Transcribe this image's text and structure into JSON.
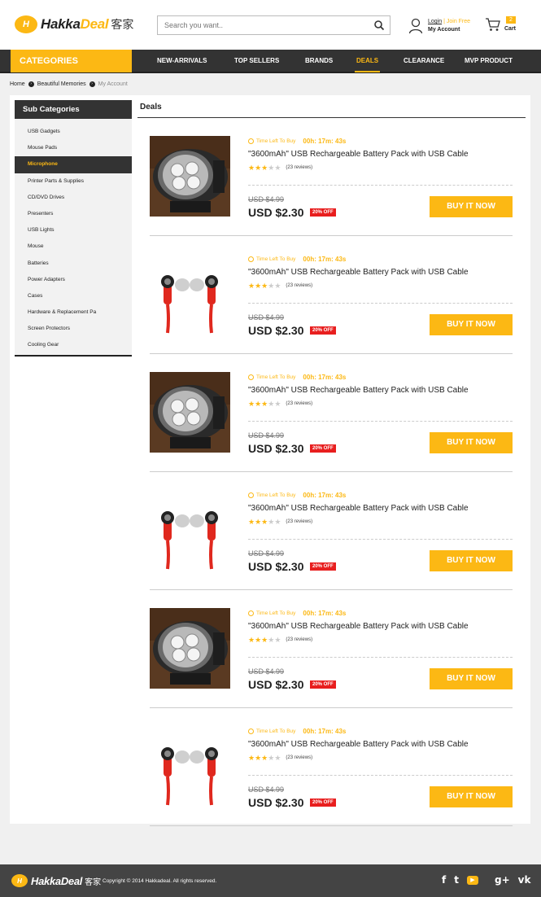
{
  "header": {
    "logo_mark": "H",
    "logo_text_1": "Hakka",
    "logo_text_2": "Deal",
    "logo_cn": "客家",
    "search_placeholder": "Search you want..",
    "login": "Login",
    "separator": "|",
    "join": "Join Free",
    "my_account": "My Account",
    "cart_count": "2",
    "cart_label": "Cart"
  },
  "nav": {
    "categories": "CATEGORIES",
    "items": [
      {
        "label": "NEW-ARRIVALS"
      },
      {
        "label": "TOP SELLERS"
      },
      {
        "label": "BRANDS"
      },
      {
        "label": "DEALS"
      },
      {
        "label": "CLEARANCE"
      },
      {
        "label": "MVP PRODUCT"
      }
    ],
    "active": "DEALS"
  },
  "breadcrumb": [
    "Home",
    "Beautiful Memories",
    "My Account"
  ],
  "sidebar": {
    "title": "Sub Categories",
    "items": [
      "USB Gadgets",
      "Mouse Pads",
      "Microphone",
      "Printer Parts & Supplies",
      "CD/DVD Drives",
      "Presenters",
      "USB Lights",
      "Mouse",
      "Batteries",
      "Power Adapters",
      "Cases",
      "Hardware & Replacement Pa",
      "Screen Protectors",
      "Cooling Gear"
    ],
    "active": "Microphone"
  },
  "deals": {
    "title": "Deals",
    "items": [
      {
        "image": "flashlight",
        "timer_label": "Time Left To Buy",
        "timer": "00h: 17m: 43s",
        "title": "\"3600mAh\" USB Rechargeable Battery Pack with USB Cable",
        "rating": 3,
        "reviews": "(23 reviews)",
        "old_price": "USD $4.99",
        "price": "USD $2.30",
        "discount": "20% OFF",
        "button": "BUY IT NOW"
      },
      {
        "image": "earphones",
        "timer_label": "Time Left To Buy",
        "timer": "00h: 17m: 43s",
        "title": "\"3600mAh\" USB Rechargeable Battery Pack with USB Cable",
        "rating": 3,
        "reviews": "(23 reviews)",
        "old_price": "USD $4.99",
        "price": "USD $2.30",
        "discount": "20% OFF",
        "button": "BUY IT NOW"
      },
      {
        "image": "flashlight",
        "timer_label": "Time Left To Buy",
        "timer": "00h: 17m: 43s",
        "title": "\"3600mAh\" USB Rechargeable Battery Pack with USB Cable",
        "rating": 3,
        "reviews": "(23 reviews)",
        "old_price": "USD $4.99",
        "price": "USD $2.30",
        "discount": "20% OFF",
        "button": "BUY IT NOW"
      },
      {
        "image": "earphones",
        "timer_label": "Time Left To Buy",
        "timer": "00h: 17m: 43s",
        "title": "\"3600mAh\" USB Rechargeable Battery Pack with USB Cable",
        "rating": 3,
        "reviews": "(23 reviews)",
        "old_price": "USD $4.99",
        "price": "USD $2.30",
        "discount": "20% OFF",
        "button": "BUY IT NOW"
      },
      {
        "image": "flashlight",
        "timer_label": "Time Left To Buy",
        "timer": "00h: 17m: 43s",
        "title": "\"3600mAh\" USB Rechargeable Battery Pack with USB Cable",
        "rating": 3,
        "reviews": "(23 reviews)",
        "old_price": "USD $4.99",
        "price": "USD $2.30",
        "discount": "20% OFF",
        "button": "BUY IT NOW"
      },
      {
        "image": "earphones",
        "timer_label": "Time Left To Buy",
        "timer": "00h: 17m: 43s",
        "title": "\"3600mAh\" USB Rechargeable Battery Pack with USB Cable",
        "rating": 3,
        "reviews": "(23 reviews)",
        "old_price": "USD $4.99",
        "price": "USD $2.30",
        "discount": "20% OFF",
        "button": "BUY IT NOW"
      }
    ]
  },
  "footer": {
    "copyright": "Copyright © 2014 Hakkadeal. All rights reserved.",
    "social": [
      "facebook-icon",
      "twitter-icon",
      "youtube-icon",
      "google-plus-icon",
      "vk-icon"
    ]
  },
  "colors": {
    "accent": "#fcb814",
    "dark": "#333333",
    "discount": "#e81e1e"
  }
}
